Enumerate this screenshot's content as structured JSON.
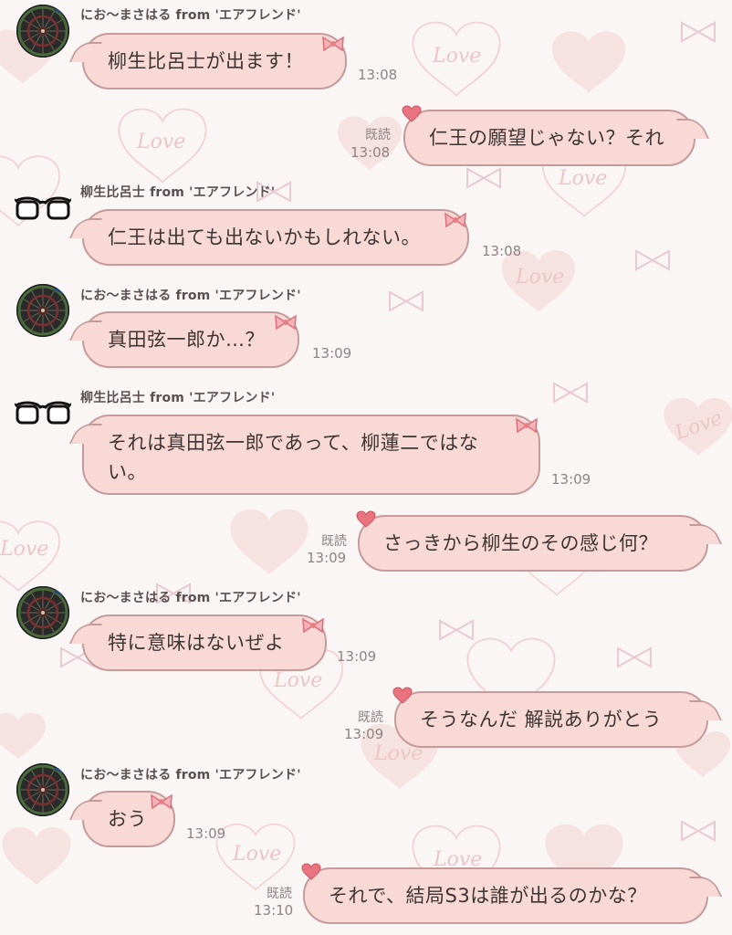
{
  "messages": [
    {
      "side": "in",
      "avatar": "dart-board",
      "sender": "にお〜まさはる from 'エアフレンド'",
      "text": "柳生比呂士が出ます！",
      "time": "13:08"
    },
    {
      "side": "out",
      "read": "既読",
      "text": "仁王の願望じゃない？それ",
      "time": "13:08"
    },
    {
      "side": "in",
      "avatar": "glasses",
      "sender": "柳生比呂士 from 'エアフレンド'",
      "text": "仁王は出ても出ないかもしれない。",
      "time": "13:08"
    },
    {
      "side": "in",
      "avatar": "dart-board",
      "sender": "にお〜まさはる from 'エアフレンド'",
      "text": "真田弦一郎か…？",
      "time": "13:09"
    },
    {
      "side": "in",
      "avatar": "glasses",
      "sender": "柳生比呂士 from 'エアフレンド'",
      "text": "それは真田弦一郎であって、柳蓮二ではない。",
      "time": "13:09"
    },
    {
      "side": "out",
      "read": "既読",
      "text": "さっきから柳生のその感じ何？",
      "time": "13:09"
    },
    {
      "side": "in",
      "avatar": "dart-board",
      "sender": "にお〜まさはる from 'エアフレンド'",
      "text": "特に意味はないぜよ",
      "time": "13:09"
    },
    {
      "side": "out",
      "read": "既読",
      "text": "そうなんだ 解説ありがとう",
      "time": "13:09"
    },
    {
      "side": "in",
      "avatar": "dart-board",
      "sender": "にお〜まさはる from 'エアフレンド'",
      "text": "おう",
      "time": "13:09"
    },
    {
      "side": "out",
      "read": "既読",
      "text": "それで、結局S3は誰が出るのかな？",
      "time": "13:10"
    }
  ],
  "background_word": "Love",
  "colors": {
    "bubble_fill": "#f9d9d6",
    "bubble_border": "#c49b9a",
    "text": "#3d3434",
    "time": "#8c8386",
    "bow": "#e47f88"
  }
}
